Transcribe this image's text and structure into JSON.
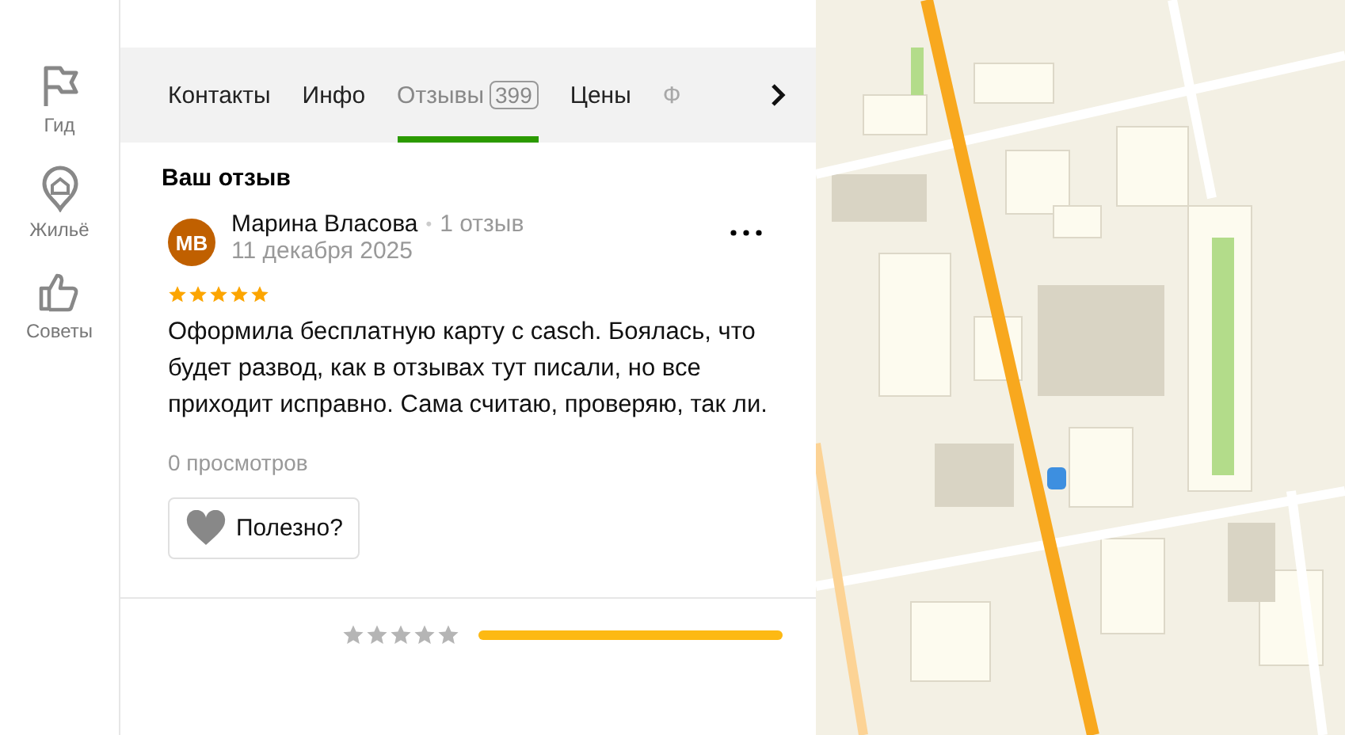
{
  "sidebar": {
    "items": [
      {
        "label": "Гид",
        "kind": "flag"
      },
      {
        "label": "Жильё",
        "kind": "house"
      },
      {
        "label": "Советы",
        "kind": "thumb"
      }
    ]
  },
  "tabs": [
    {
      "label": "Контакты",
      "selected": false,
      "faded": false
    },
    {
      "label": "Инфо",
      "selected": false,
      "faded": false
    },
    {
      "label": "Отзывы",
      "badge": "399",
      "selected": true,
      "faded": false
    },
    {
      "label": "Цены",
      "selected": false,
      "faded": false
    },
    {
      "label": "Ф",
      "selected": false,
      "faded": true
    }
  ],
  "section_title": "Ваш отзыв",
  "review": {
    "avatar": "МВ",
    "author": "Марина Власова",
    "separator": "•",
    "author_reviews": "1 отзыв",
    "date": "11 декабря 2025",
    "stars": 5,
    "text": "Оформила бесплатную карту с casch. Боялась, что будет развод, как в отзывах тут писали, но все приходит исправно. Сама считаю, проверяю, так ли.",
    "views": "0 просмотров",
    "helpful_button": "Полезно?"
  },
  "rating_bars": [
    {
      "stars": 0,
      "level": 1
    }
  ]
}
